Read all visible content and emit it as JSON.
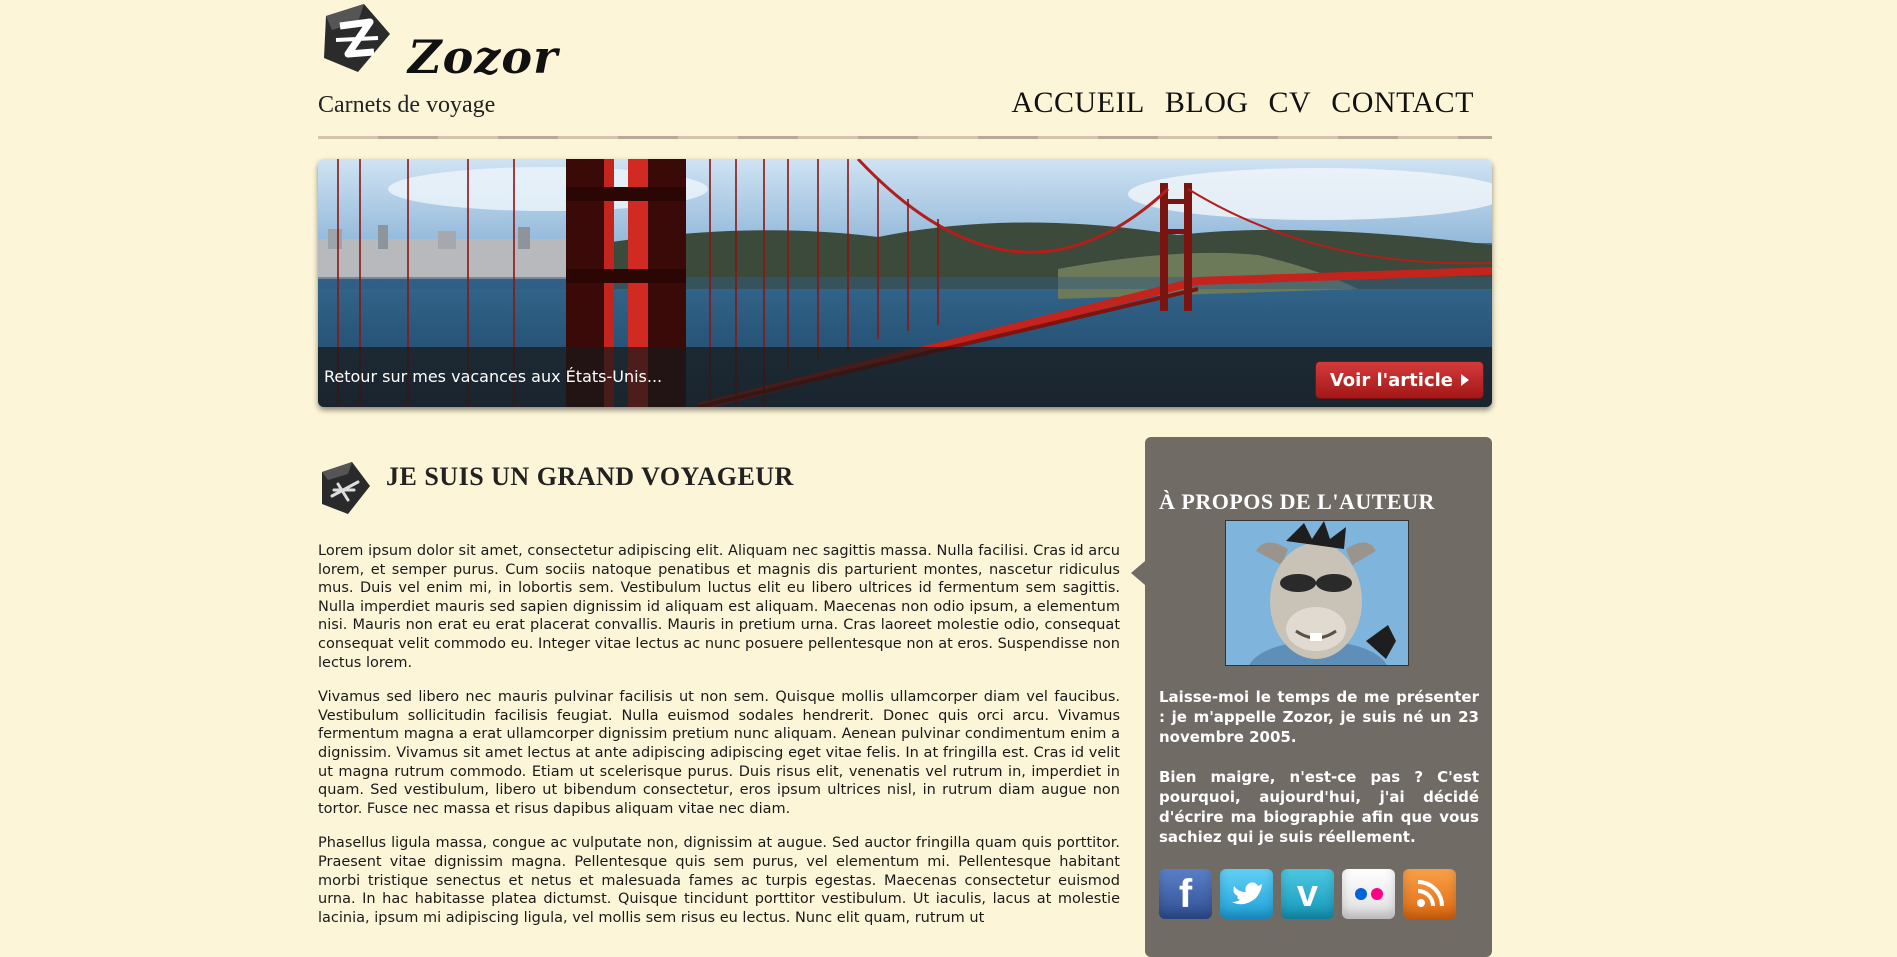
{
  "site": {
    "title": "Zozor",
    "tagline": "Carnets de voyage"
  },
  "nav": {
    "items": [
      "ACCUEIL",
      "BLOG",
      "CV",
      "CONTACT"
    ]
  },
  "banner": {
    "caption": "Retour sur mes vacances aux États-Unis...",
    "button_label": "Voir l'article"
  },
  "article": {
    "title": "JE SUIS UN GRAND VOYAGEUR",
    "paragraphs": [
      "Lorem ipsum dolor sit amet, consectetur adipiscing elit. Aliquam nec sagittis massa. Nulla facilisi. Cras id arcu lorem, et semper purus. Cum sociis natoque penatibus et magnis dis parturient montes, nascetur ridiculus mus. Duis vel enim mi, in lobortis sem. Vestibulum luctus elit eu libero ultrices id fermentum sem sagittis. Nulla imperdiet mauris sed sapien dignissim id aliquam est aliquam. Maecenas non odio ipsum, a elementum nisi. Mauris non erat eu erat placerat convallis. Mauris in pretium urna. Cras laoreet molestie odio, consequat consequat velit commodo eu. Integer vitae lectus ac nunc posuere pellentesque non at eros. Suspendisse non lectus lorem.",
      "Vivamus sed libero nec mauris pulvinar facilisis ut non sem. Quisque mollis ullamcorper diam vel faucibus. Vestibulum sollicitudin facilisis feugiat. Nulla euismod sodales hendrerit. Donec quis orci arcu. Vivamus fermentum magna a erat ullamcorper dignissim pretium nunc aliquam. Aenean pulvinar condimentum enim a dignissim. Vivamus sit amet lectus at ante adipiscing adipiscing eget vitae felis. In at fringilla est. Cras id velit ut magna rutrum commodo. Etiam ut scelerisque purus. Duis risus elit, venenatis vel rutrum in, imperdiet in quam. Sed vestibulum, libero ut bibendum consectetur, eros ipsum ultrices nisl, in rutrum diam augue non tortor. Fusce nec massa et risus dapibus aliquam vitae nec diam.",
      "Phasellus ligula massa, congue ac vulputate non, dignissim at augue. Sed auctor fringilla quam quis porttitor. Praesent vitae dignissim magna. Pellentesque quis sem purus, vel elementum mi. Pellentesque habitant morbi tristique senectus et netus et malesuada fames ac turpis egestas. Maecenas consectetur euismod urna. In hac habitasse platea dictumst. Quisque tincidunt porttitor vestibulum. Ut iaculis, lacus at molestie lacinia, ipsum mi adipiscing ligula, vel mollis sem risus eu lectus. Nunc elit quam, rutrum ut"
    ]
  },
  "aside": {
    "title": "À PROPOS DE L'AUTEUR",
    "paragraphs": [
      "Laisse-moi le temps de me présenter : je m'appelle Zozor, je suis né un 23 novembre 2005.",
      "Bien maigre, n'est-ce pas ? C'est pourquoi, aujourd'hui, j'ai décidé d'écrire ma biographie afin que vous sachiez qui je suis réellement."
    ],
    "social": [
      {
        "name": "facebook-icon",
        "glyph": "f",
        "color": "#3b5998"
      },
      {
        "name": "twitter-icon",
        "glyph": "t",
        "color": "#1da0d9"
      },
      {
        "name": "vimeo-icon",
        "glyph": "v",
        "color": "#1596b7"
      },
      {
        "name": "flickr-icon",
        "glyph": "",
        "color": "#ff0084"
      },
      {
        "name": "rss-icon",
        "glyph": "",
        "color": "#f26522"
      }
    ]
  },
  "colors": {
    "background": "#fdf5d8",
    "sidebar": "#716b66",
    "button_red": "#b82020"
  }
}
